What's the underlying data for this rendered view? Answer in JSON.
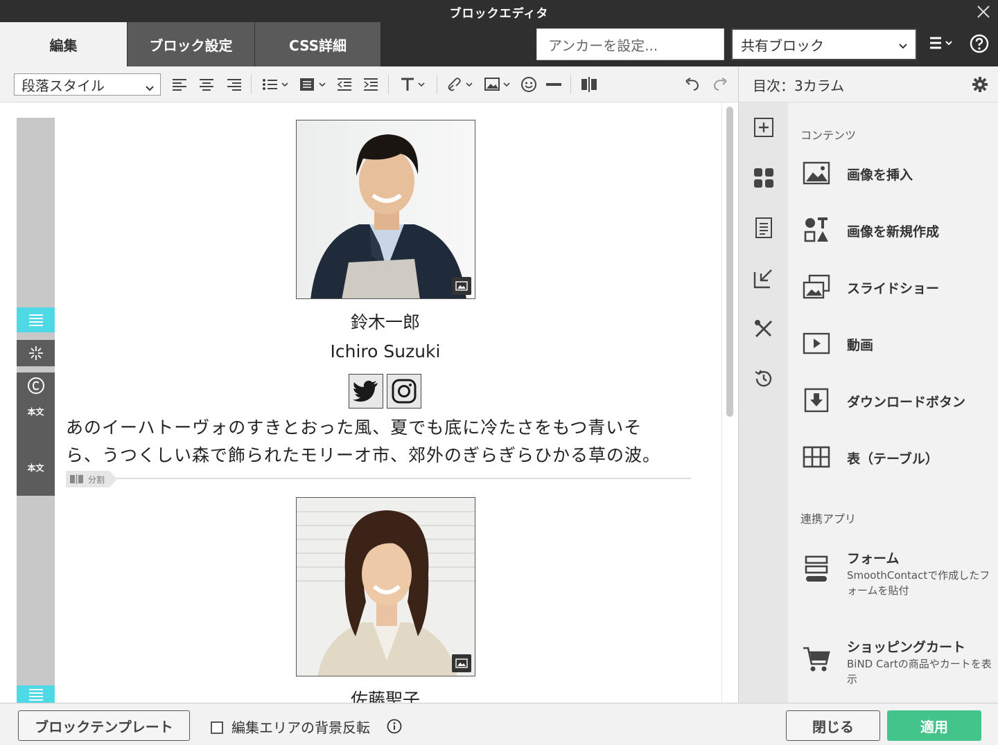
{
  "window": {
    "title": "ブロックエディタ"
  },
  "tabs": [
    {
      "label": "編集",
      "active": true
    },
    {
      "label": "ブロック設定",
      "active": false
    },
    {
      "label": "CSS詳細",
      "active": false
    }
  ],
  "header": {
    "anchor_placeholder": "アンカーを設定...",
    "shared_block": "共有ブロック"
  },
  "toolbar": {
    "paragraph_style": "段落スタイル"
  },
  "toc": {
    "label": "目次：3カラム"
  },
  "editor": {
    "gutter_labels": [
      "本文",
      "本文"
    ],
    "person1": {
      "name_ja": "鈴木一郎",
      "name_en": "Ichiro Suzuki"
    },
    "body_text_line1": "あのイーハトーヴォのすきとおった風、夏でも底に冷たさをもつ青いそ",
    "body_text_line2": "ら、うつくしい森で飾られたモリーオ市、郊外のぎらぎらひかる草の波。",
    "split_label": "分割",
    "person2": {
      "name_ja": "佐藤聖子"
    }
  },
  "side_panel": {
    "contents_title": "コンテンツ",
    "items": [
      {
        "label": "画像を挿入",
        "icon": "image-icon"
      },
      {
        "label": "画像を新規作成",
        "icon": "shapes-icon"
      },
      {
        "label": "スライドショー",
        "icon": "slideshow-icon"
      },
      {
        "label": "動画",
        "icon": "video-icon"
      },
      {
        "label": "ダウンロードボタン",
        "icon": "download-icon"
      },
      {
        "label": "表（テーブル）",
        "icon": "table-icon"
      }
    ],
    "apps_title": "連携アプリ",
    "apps": [
      {
        "label": "フォーム",
        "desc": "SmoothContactで作成したフォームを貼付",
        "icon": "form-icon"
      },
      {
        "label": "ショッピングカート",
        "desc": "BiND Cartの商品やカートを表示",
        "icon": "cart-icon"
      }
    ]
  },
  "footer": {
    "template_button": "ブロックテンプレート",
    "invert_label": "編集エリアの背景反転",
    "close_button": "閉じる",
    "apply_button": "適用"
  },
  "colors": {
    "accent_green": "#43c48a",
    "gutter_cyan": "#4fd9e6",
    "dark_header": "#2f2f2f"
  }
}
